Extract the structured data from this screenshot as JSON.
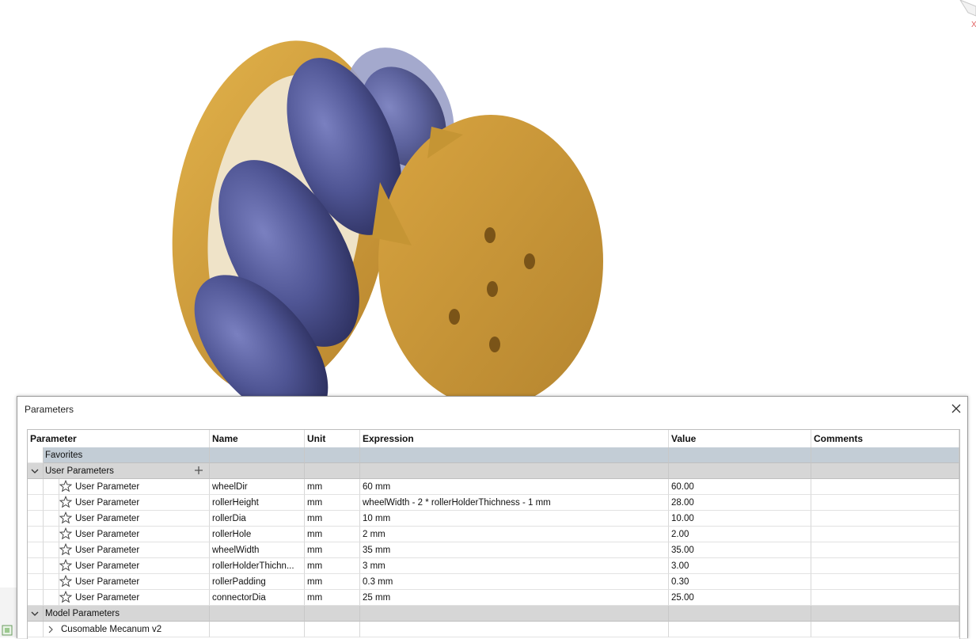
{
  "dialog": {
    "title": "Parameters"
  },
  "columns": {
    "parameter": "Parameter",
    "name": "Name",
    "unit": "Unit",
    "expression": "Expression",
    "value": "Value",
    "comments": "Comments"
  },
  "groups": {
    "favorites": "Favorites",
    "user_parameters": "User Parameters",
    "model_parameters": "Model Parameters",
    "model_child": "Cusomable Mecanum v2"
  },
  "rows": [
    {
      "type": "User Parameter",
      "name": "wheelDir",
      "unit": "mm",
      "expression": "60 mm",
      "value": "60.00",
      "comment": ""
    },
    {
      "type": "User Parameter",
      "name": "rollerHeight",
      "unit": "mm",
      "expression": "wheelWidth - 2 * rollerHolderThichness - 1 mm",
      "value": "28.00",
      "comment": ""
    },
    {
      "type": "User Parameter",
      "name": "rollerDia",
      "unit": "mm",
      "expression": "10 mm",
      "value": "10.00",
      "comment": ""
    },
    {
      "type": "User Parameter",
      "name": "rollerHole",
      "unit": "mm",
      "expression": "2 mm",
      "value": "2.00",
      "comment": ""
    },
    {
      "type": "User Parameter",
      "name": "wheelWidth",
      "unit": "mm",
      "expression": "35 mm",
      "value": "35.00",
      "comment": ""
    },
    {
      "type": "User Parameter",
      "name": "rollerHolderThichn...",
      "unit": "mm",
      "expression": "3 mm",
      "value": "3.00",
      "comment": ""
    },
    {
      "type": "User Parameter",
      "name": "rollerPadding",
      "unit": "mm",
      "expression": "0.3 mm",
      "value": "0.30",
      "comment": ""
    },
    {
      "type": "User Parameter",
      "name": "connectorDia",
      "unit": "mm",
      "expression": "25 mm",
      "value": "25.00",
      "comment": ""
    }
  ],
  "colors": {
    "wheel_body": "#d3a23e",
    "roller": "#4f5594",
    "favorites_bg": "#c3cdd6",
    "group_bg": "#d6d6d6"
  },
  "icons": {
    "star": "star-icon",
    "close": "close-icon",
    "expand": "chevron-down-icon",
    "collapse": "chevron-right-icon",
    "add": "plus-icon"
  }
}
